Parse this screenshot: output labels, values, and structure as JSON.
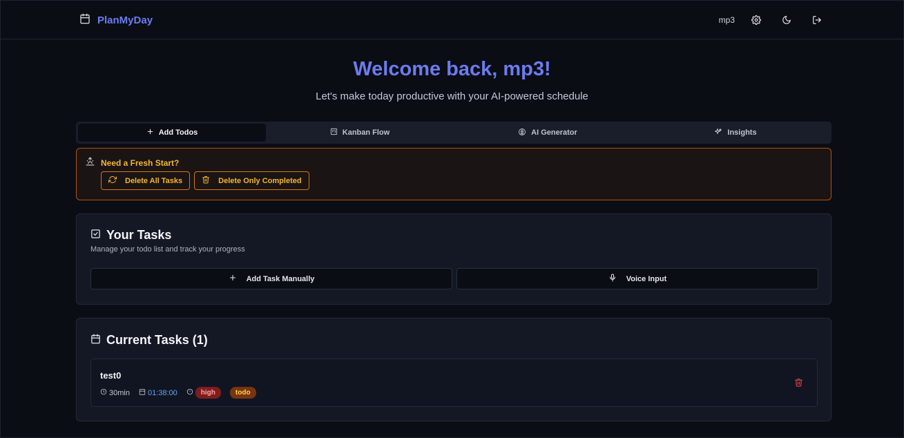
{
  "header": {
    "app_name": "PlanMyDay",
    "user_name": "mp3",
    "icons": [
      "calendar-icon",
      "gear-icon",
      "moon-icon",
      "logout-icon"
    ]
  },
  "hero": {
    "title": "Welcome back, mp3!",
    "subtitle": "Let's make today productive with your AI-powered schedule"
  },
  "tabs": [
    {
      "label": "Add Todos",
      "icon": "plus-icon",
      "active": true
    },
    {
      "label": "Kanban Flow",
      "icon": "kanban-icon",
      "active": false
    },
    {
      "label": "AI Generator",
      "icon": "brain-icon",
      "active": false
    },
    {
      "label": "Insights",
      "icon": "sparkles-icon",
      "active": false
    }
  ],
  "fresh_start": {
    "title": "Need a Fresh Start?",
    "delete_all_label": "Delete All Tasks",
    "delete_completed_label": "Delete Only Completed"
  },
  "your_tasks": {
    "title": "Your Tasks",
    "description": "Manage your todo list and track your progress",
    "add_manual_label": "Add Task Manually",
    "voice_label": "Voice Input"
  },
  "current_tasks": {
    "title": "Current Tasks (1)",
    "tasks": [
      {
        "name": "test0",
        "duration": "30min",
        "time": "01:38:00",
        "priority": "high",
        "status": "todo"
      }
    ]
  },
  "colors": {
    "accent": "#6b7cf0",
    "warning": "#f5b82e",
    "danger": "#ef4444",
    "background": "#0b0d14"
  }
}
